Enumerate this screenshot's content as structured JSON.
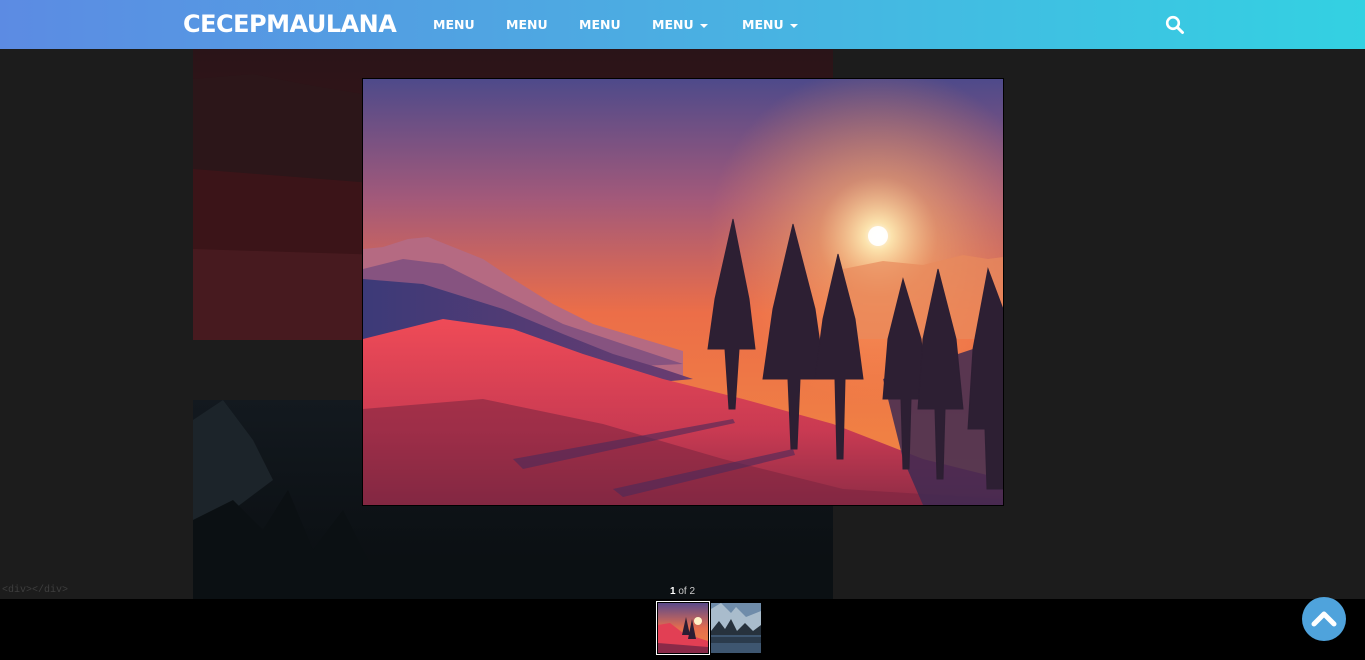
{
  "header": {
    "brand": "CECEPMAULANA",
    "menu": [
      {
        "label": "MENU",
        "dropdown": false
      },
      {
        "label": "MENU",
        "dropdown": false
      },
      {
        "label": "MENU",
        "dropdown": false
      },
      {
        "label": "MENU",
        "dropdown": true
      },
      {
        "label": "MENU",
        "dropdown": true
      }
    ],
    "search_icon": "search-icon"
  },
  "page": {
    "stray_text": "<div></div>"
  },
  "lightbox": {
    "current": "1",
    "of_text": " of 2",
    "thumbnails": [
      {
        "name": "sunset-snow-thumbnail",
        "active": true
      },
      {
        "name": "mountain-lake-thumbnail",
        "active": false
      }
    ]
  },
  "colors": {
    "navbar_start": "#5c8be3",
    "navbar_end": "#33d1e2",
    "scroll_top": "#4fa3dc"
  },
  "scroll_top_icon": "chevron-up-icon"
}
